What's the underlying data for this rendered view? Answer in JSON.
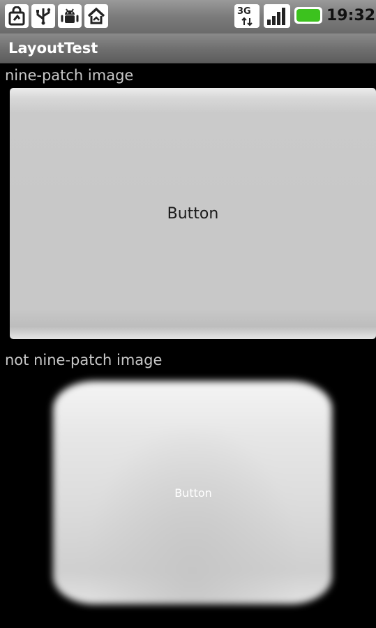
{
  "status_bar": {
    "time": "19:32",
    "network_type": "3G",
    "icons": [
      "shopping-bag-icon",
      "usb-icon",
      "android-debug-icon",
      "home-icon"
    ]
  },
  "title_bar": {
    "title": "LayoutTest"
  },
  "content": {
    "label_ninepatch": "nine-patch image",
    "button_ninepatch": "Button",
    "label_not_ninepatch": "not nine-patch image",
    "button_not_ninepatch": "Button"
  },
  "colors": {
    "background": "#000000",
    "button_face": "#c8c8c8",
    "label_text": "#c8c8c8",
    "battery_green": "#3cc21e"
  }
}
